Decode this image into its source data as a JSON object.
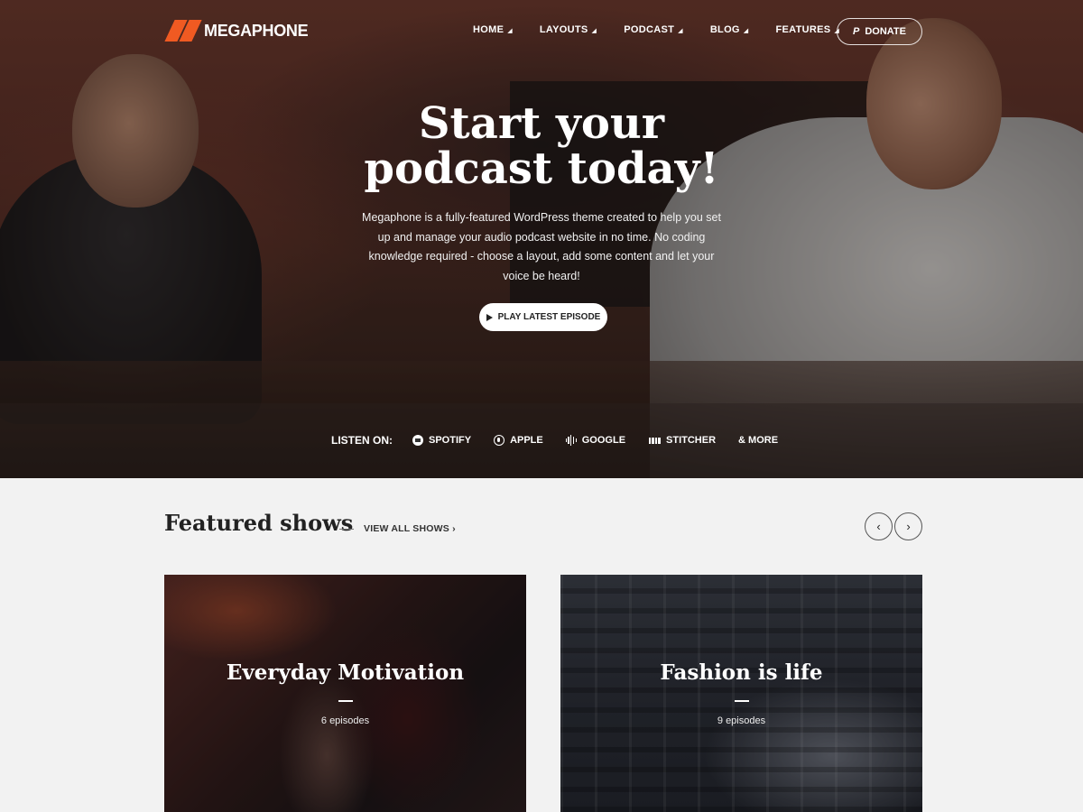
{
  "brand": {
    "name": "MEGAPHONE",
    "accent": "#f05a22"
  },
  "nav": {
    "items": [
      {
        "label": "HOME"
      },
      {
        "label": "LAYOUTS"
      },
      {
        "label": "PODCAST"
      },
      {
        "label": "BLOG"
      },
      {
        "label": "FEATURES"
      }
    ],
    "donate_label": "DONATE"
  },
  "hero": {
    "title_line1": "Start your",
    "title_line2": "podcast today!",
    "description": "Megaphone is a fully-featured WordPress theme created to help you set up and manage your audio podcast website in no time. No coding knowledge required - choose a layout, add some content and let your voice be heard!",
    "play_label": "PLAY LATEST EPISODE"
  },
  "listen": {
    "label": "LISTEN ON:",
    "platforms": [
      {
        "label": "SPOTIFY",
        "icon": "spotify-icon"
      },
      {
        "label": "APPLE",
        "icon": "apple-podcast-icon"
      },
      {
        "label": "GOOGLE",
        "icon": "google-podcast-icon"
      },
      {
        "label": "STITCHER",
        "icon": "stitcher-icon"
      },
      {
        "label": "& MORE",
        "icon": ""
      }
    ]
  },
  "featured": {
    "title": "Featured shows",
    "view_all": "VIEW ALL SHOWS ›",
    "prev": "‹",
    "next": "›",
    "shows": [
      {
        "title": "Everyday Motivation",
        "meta": "6 episodes"
      },
      {
        "title": "Fashion is life",
        "meta": "9 episodes"
      }
    ]
  }
}
